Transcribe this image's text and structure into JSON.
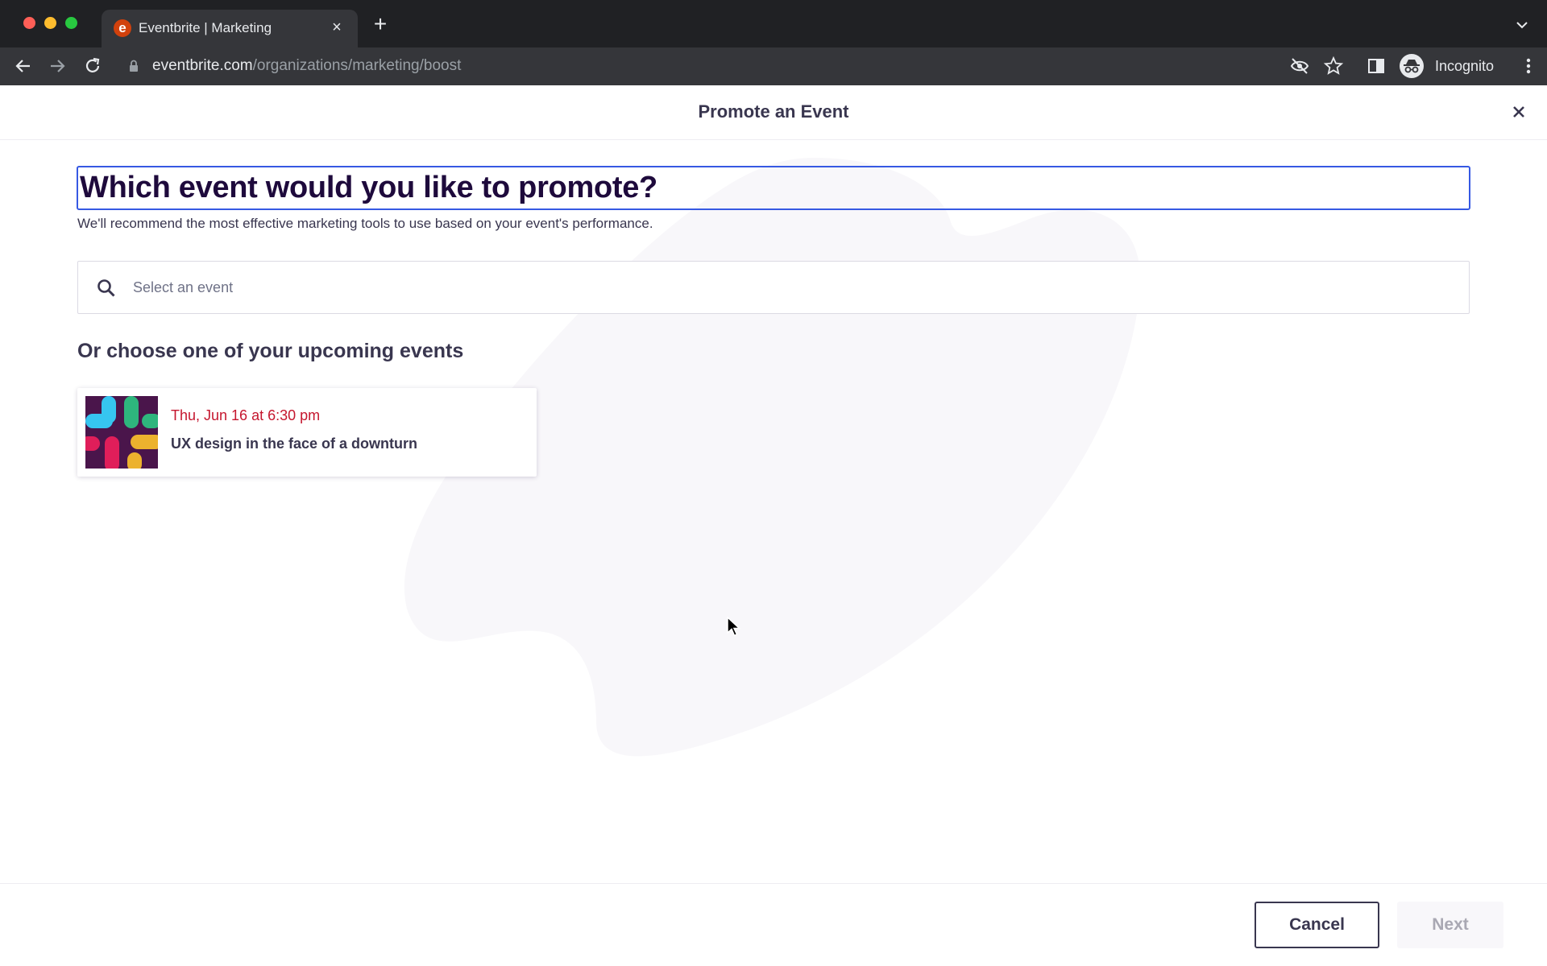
{
  "browser": {
    "tab_title": "Eventbrite | Marketing",
    "tab_favicon_letter": "e",
    "url_domain": "eventbrite.com",
    "url_path": "/organizations/marketing/boost",
    "profile_label": "Incognito",
    "icons": [
      "back-icon",
      "forward-icon",
      "reload-icon",
      "lock-icon",
      "eye-off-icon",
      "star-icon",
      "side-panel-icon",
      "incognito-icon",
      "more-icon"
    ]
  },
  "modal": {
    "title": "Promote an Event",
    "heading": "Which event would you like to promote?",
    "subheading": "We'll recommend the most effective marketing tools to use based on your event's performance.",
    "search": {
      "placeholder": "Select an event",
      "value": ""
    },
    "upcoming_title": "Or choose one of your upcoming events",
    "events": [
      {
        "date": "Thu, Jun 16 at 6:30 pm",
        "name": "UX design in the face of a downturn"
      }
    ],
    "footer": {
      "cancel_label": "Cancel",
      "next_label": "Next",
      "next_enabled": false
    }
  },
  "colors": {
    "accent_focus": "#3659e3",
    "event_date": "#c5162e",
    "heading": "#1e0a3c",
    "text": "#39364f"
  }
}
